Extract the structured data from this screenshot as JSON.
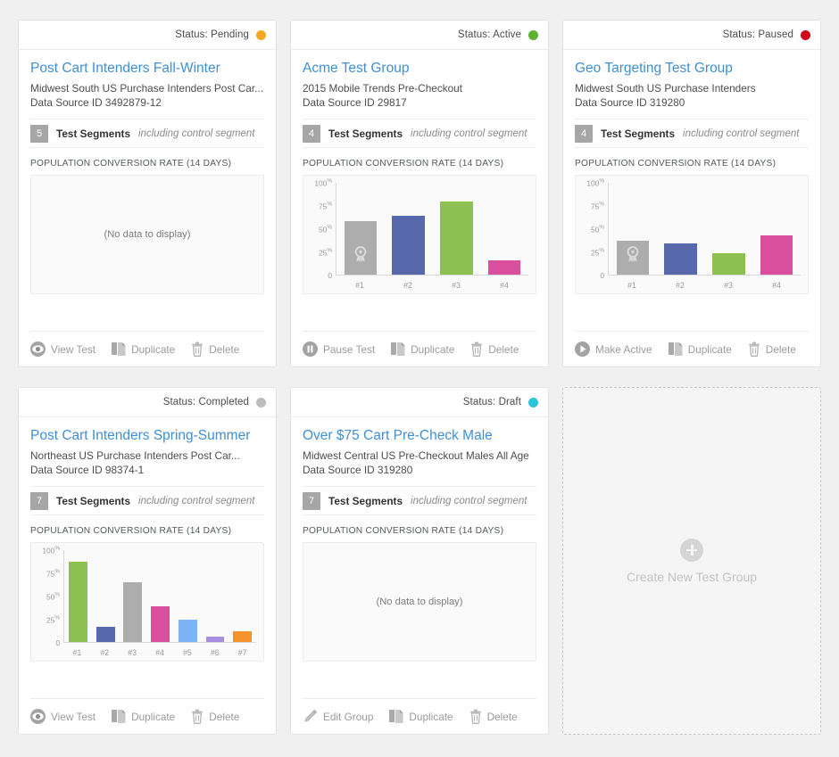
{
  "labels": {
    "status_prefix": "Status: ",
    "test_segments": "Test Segments",
    "control_note": "including control segment",
    "chart_caption": "POPULATION CONVERSION RATE (14 DAYS)",
    "no_data": "(No data to display)",
    "create_new": "Create New Test Group"
  },
  "status_colors": {
    "pending": "#f5a623",
    "active": "#5cb130",
    "paused": "#d0021b",
    "completed": "#bdbdbd",
    "draft": "#2ec3dd"
  },
  "series_colors": {
    "control": "#adadad",
    "s2": "#5769ab",
    "s3": "#8cc152",
    "s4": "#d94f9e",
    "s5": "#7fb3f7",
    "s6": "#a98ee0",
    "s7": "#f5942e"
  },
  "cards": [
    {
      "status_label": "Pending",
      "status_key": "pending",
      "title": "Post Cart Intenders Fall-Winter",
      "subtitle": "Midwest South US Purchase Intenders Post Car...",
      "data_source": "Data Source ID 3492879-12",
      "segment_count": "5",
      "actions": [
        {
          "label": "View Test",
          "icon": "eye-icon"
        },
        {
          "label": "Duplicate",
          "icon": "copy-icon"
        },
        {
          "label": "Delete",
          "icon": "trash-icon"
        }
      ],
      "chart_data": {
        "type": "bar",
        "title": "POPULATION CONVERSION RATE (14 DAYS)",
        "empty": true,
        "empty_text": "(No data to display)",
        "categories": [],
        "values": [],
        "ylabel": "",
        "xlabel": "",
        "ylim": [
          0,
          100
        ]
      }
    },
    {
      "status_label": "Active",
      "status_key": "active",
      "title": "Acme Test Group",
      "subtitle": "2015 Mobile Trends Pre-Checkout",
      "data_source": "Data Source ID 29817",
      "segment_count": "4",
      "actions": [
        {
          "label": "Pause Test",
          "icon": "pause-icon"
        },
        {
          "label": "Duplicate",
          "icon": "copy-icon"
        },
        {
          "label": "Delete",
          "icon": "trash-icon"
        }
      ],
      "chart_data": {
        "type": "bar",
        "title": "POPULATION CONVERSION RATE (14 DAYS)",
        "empty": false,
        "categories": [
          "#1",
          "#2",
          "#3",
          "#4"
        ],
        "values": [
          58,
          64,
          80,
          16
        ],
        "colors": [
          "#adadad",
          "#5769ab",
          "#8cc152",
          "#d94f9e"
        ],
        "control_index": 0,
        "yticks": [
          0,
          25,
          50,
          75,
          100
        ],
        "ytick_labels": [
          "0",
          "25%",
          "50%",
          "75%",
          "100%"
        ],
        "ylabel": "",
        "xlabel": "",
        "ylim": [
          0,
          100
        ],
        "grid": false,
        "legend": "none"
      }
    },
    {
      "status_label": "Paused",
      "status_key": "paused",
      "title": "Geo Targeting Test Group",
      "subtitle": "Midwest South US Purchase Intenders",
      "data_source": "Data Source ID 319280",
      "segment_count": "4",
      "actions": [
        {
          "label": "Make Active",
          "icon": "play-icon"
        },
        {
          "label": "Duplicate",
          "icon": "copy-icon"
        },
        {
          "label": "Delete",
          "icon": "trash-icon"
        }
      ],
      "chart_data": {
        "type": "bar",
        "title": "POPULATION CONVERSION RATE (14 DAYS)",
        "empty": false,
        "categories": [
          "#1",
          "#2",
          "#3",
          "#4"
        ],
        "values": [
          37,
          34,
          23,
          43
        ],
        "colors": [
          "#adadad",
          "#5769ab",
          "#8cc152",
          "#d94f9e"
        ],
        "control_index": 0,
        "yticks": [
          0,
          25,
          50,
          75,
          100
        ],
        "ytick_labels": [
          "0",
          "25%",
          "50%",
          "75%",
          "100%"
        ],
        "ylabel": "",
        "xlabel": "",
        "ylim": [
          0,
          100
        ],
        "grid": false,
        "legend": "none"
      }
    },
    {
      "status_label": "Completed",
      "status_key": "completed",
      "title": "Post Cart Intenders Spring-Summer",
      "subtitle": "Northeast US Purchase Intenders Post Car...",
      "data_source": "Data Source ID 98374-1",
      "segment_count": "7",
      "actions": [
        {
          "label": "View Test",
          "icon": "eye-icon"
        },
        {
          "label": "Duplicate",
          "icon": "copy-icon"
        },
        {
          "label": "Delete",
          "icon": "trash-icon"
        }
      ],
      "chart_data": {
        "type": "bar",
        "title": "POPULATION CONVERSION RATE (14 DAYS)",
        "empty": false,
        "categories": [
          "#1",
          "#2",
          "#3",
          "#4",
          "#5",
          "#6",
          "#7"
        ],
        "values": [
          87,
          17,
          65,
          39,
          24,
          6,
          12
        ],
        "colors": [
          "#8cc152",
          "#5769ab",
          "#adadad",
          "#d94f9e",
          "#7fb3f7",
          "#a98ee0",
          "#f5942e"
        ],
        "control_index": -1,
        "yticks": [
          0,
          25,
          50,
          75,
          100
        ],
        "ytick_labels": [
          "0",
          "25%",
          "50%",
          "75%",
          "100%"
        ],
        "ylabel": "",
        "xlabel": "",
        "ylim": [
          0,
          100
        ],
        "grid": false,
        "legend": "none"
      }
    },
    {
      "status_label": "Draft",
      "status_key": "draft",
      "title": "Over $75 Cart Pre-Check Male",
      "subtitle": "Midwest Central US Pre-Checkout Males All Age",
      "data_source": "Data Source ID 319280",
      "segment_count": "7",
      "actions": [
        {
          "label": "Edit Group",
          "icon": "pencil-icon"
        },
        {
          "label": "Duplicate",
          "icon": "copy-icon"
        },
        {
          "label": "Delete",
          "icon": "trash-icon"
        }
      ],
      "chart_data": {
        "type": "bar",
        "title": "POPULATION CONVERSION RATE (14 DAYS)",
        "empty": true,
        "empty_text": "(No data to display)",
        "categories": [],
        "values": [],
        "ylabel": "",
        "xlabel": "",
        "ylim": [
          0,
          100
        ]
      }
    }
  ]
}
